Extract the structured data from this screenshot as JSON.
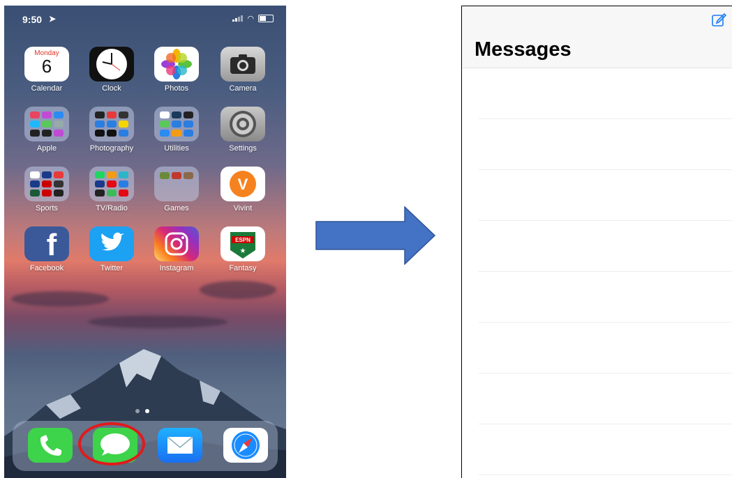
{
  "phone": {
    "status": {
      "time": "9:50"
    },
    "apps": [
      {
        "label": "Calendar",
        "calendar_day": "Monday",
        "calendar_date": "6"
      },
      {
        "label": "Clock"
      },
      {
        "label": "Photos"
      },
      {
        "label": "Camera"
      },
      {
        "label": "Apple"
      },
      {
        "label": "Photography"
      },
      {
        "label": "Utilities"
      },
      {
        "label": "Settings"
      },
      {
        "label": "Sports"
      },
      {
        "label": "TV/Radio"
      },
      {
        "label": "Games"
      },
      {
        "label": "Vivint",
        "glyph": "V"
      },
      {
        "label": "Facebook",
        "glyph": "f"
      },
      {
        "label": "Twitter"
      },
      {
        "label": "Instagram"
      },
      {
        "label": "Fantasy",
        "glyph": "ESPN"
      }
    ],
    "dock": [
      "phone-icon",
      "messages-icon",
      "mail-icon",
      "safari-icon"
    ],
    "highlight_color": "#e01b1b"
  },
  "arrow_color": "#4472c4",
  "messages": {
    "title": "Messages"
  }
}
